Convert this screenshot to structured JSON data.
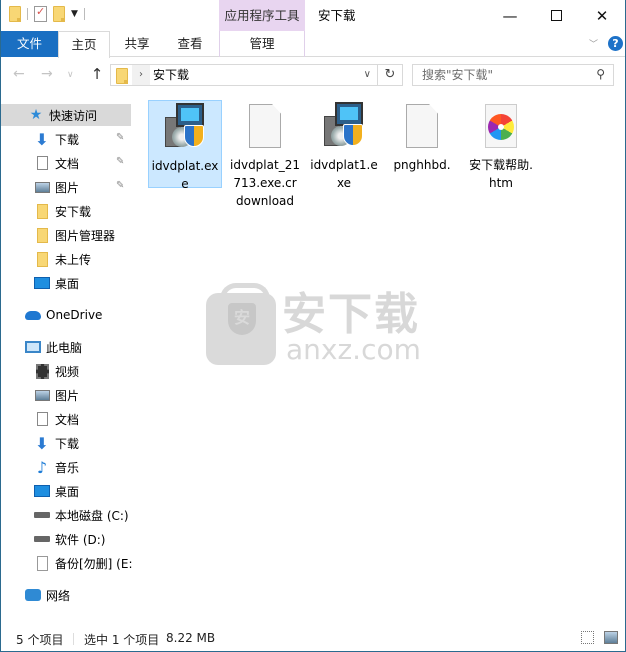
{
  "window": {
    "title": "安下载",
    "app_tools_label": "应用程序工具",
    "minimize": "—",
    "maximize": "",
    "close": "✕"
  },
  "ribbon": {
    "tabs": [
      {
        "label": "文件"
      },
      {
        "label": "主页"
      },
      {
        "label": "共享"
      },
      {
        "label": "查看"
      },
      {
        "label": "管理"
      }
    ],
    "expand_icon": "﹀",
    "help_icon": "?"
  },
  "nav": {
    "back": "←",
    "forward": "→",
    "recent": "∨",
    "up": "↑",
    "address_chevron": "›",
    "address_path": "安下载",
    "address_dropdown": "∨",
    "refresh": "↻",
    "search_placeholder": "搜索\"安下载\"",
    "search_icon": "⚲"
  },
  "sidebar": {
    "items": [
      {
        "label": "快速访问",
        "icon": "star-icon",
        "selected": true
      },
      {
        "label": "下载",
        "icon": "download-icon",
        "pinned": true
      },
      {
        "label": "文档",
        "icon": "document-icon",
        "pinned": true
      },
      {
        "label": "图片",
        "icon": "pictures-icon",
        "pinned": true
      },
      {
        "label": "安下载",
        "icon": "folder-icon"
      },
      {
        "label": "图片管理器",
        "icon": "folder-icon"
      },
      {
        "label": "未上传",
        "icon": "folder-icon"
      },
      {
        "label": "桌面",
        "icon": "desktop-icon"
      },
      {
        "label": "OneDrive",
        "icon": "onedrive-icon"
      },
      {
        "label": "此电脑",
        "icon": "computer-icon"
      },
      {
        "label": "视频",
        "icon": "video-icon"
      },
      {
        "label": "图片",
        "icon": "pictures-icon"
      },
      {
        "label": "文档",
        "icon": "document-icon"
      },
      {
        "label": "下载",
        "icon": "download-icon"
      },
      {
        "label": "音乐",
        "icon": "music-icon"
      },
      {
        "label": "桌面",
        "icon": "desktop-icon"
      },
      {
        "label": "本地磁盘 (C:)",
        "icon": "drive-icon"
      },
      {
        "label": "软件 (D:)",
        "icon": "drive-icon"
      },
      {
        "label": "备份[勿删] (E:",
        "icon": "file-icon"
      },
      {
        "label": "网络",
        "icon": "network-icon"
      }
    ],
    "pin_glyph": "📌"
  },
  "files": [
    {
      "name": "idvdplat.exe",
      "type": "setup",
      "selected": true
    },
    {
      "name": "idvdplat_21713.exe.crdownload",
      "type": "blank"
    },
    {
      "name": "idvdplat1.exe",
      "type": "setup"
    },
    {
      "name": "pnghhbd.",
      "type": "blank"
    },
    {
      "name": "安下载帮助.htm",
      "type": "htm"
    }
  ],
  "watermark": {
    "shield_char": "安",
    "cn_text": "安下载",
    "en_text": "anxz.com"
  },
  "status": {
    "item_count": "5 个项目",
    "selected": "选中 1 个项目",
    "size": "8.22 MB"
  }
}
